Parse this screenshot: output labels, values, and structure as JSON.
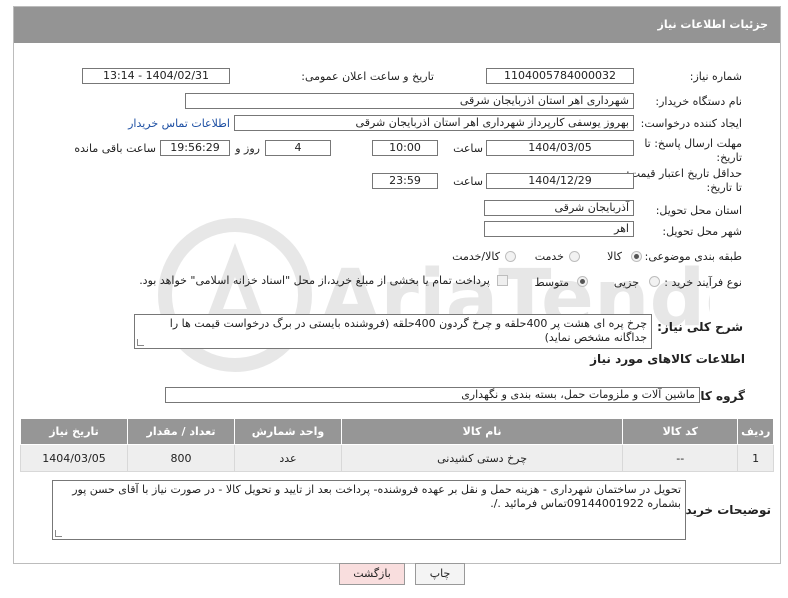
{
  "header": {
    "title": "جزئیات اطلاعات نیاز"
  },
  "fields": {
    "need_number_label": "شماره نیاز:",
    "need_number": "1104005784000032",
    "announce_label": "تاریخ و ساعت اعلان عمومی:",
    "announce_value": "1404/02/31 - 13:14",
    "buyer_org_label": "نام دستگاه خریدار:",
    "buyer_org": "شهرداری اهر استان اذربایجان شرقی",
    "requester_label": "ایجاد کننده درخواست:",
    "requester": "بهروز یوسفی کارپرداز شهرداری اهر استان اذربایجان شرقی",
    "contact_link": "اطلاعات تماس خریدار",
    "deadline_label": "مهلت ارسال پاسخ: تا",
    "deadline_label2": "تاریخ:",
    "deadline_date": "1404/03/05",
    "time_label": "ساعت",
    "deadline_time": "10:00",
    "days_value": "4",
    "days_label": "روز و",
    "remaining_time": "19:56:29",
    "remaining_label": "ساعت باقی مانده",
    "validity_label": "حداقل تاریخ اعتبار قیمت:",
    "validity_label2": "تا تاریخ:",
    "validity_date": "1404/12/29",
    "validity_time": "23:59",
    "province_label": "استان محل تحویل:",
    "province": "آذربایجان شرقی",
    "city_label": "شهر محل تحویل:",
    "city": "اهر",
    "category_label": "طبقه بندی موضوعی:",
    "category_options": [
      "کالا",
      "خدمت",
      "کالا/خدمت"
    ],
    "process_label": "نوع فرآیند خرید :",
    "process_options": [
      "جزیی",
      "متوسط"
    ],
    "payment_note": "پرداخت تمام یا بخشی از مبلغ خرید،از محل \"اسناد خزانه اسلامی\" خواهد بود."
  },
  "description": {
    "label": "شرح کلی نیاز:",
    "text": "چرخ پره ای هشت پر 400حلقه و چرخ گردون 400حلقه (فروشنده بایستی در برگ درخواست قیمت ها را جداگانه مشخص نماید)"
  },
  "goods": {
    "section_title": "اطلاعات کالاهای مورد نیاز",
    "group_label": "گروه کالا:",
    "group_value": "ماشین آلات و ملزومات حمل، بسته بندی و نگهداری",
    "columns": [
      "ردیف",
      "کد کالا",
      "نام کالا",
      "واحد شمارش",
      "تعداد / مقدار",
      "تاریخ نیاز"
    ],
    "rows": [
      {
        "index": "1",
        "code": "--",
        "name": "چرخ دستی کشیدنی",
        "unit": "عدد",
        "qty": "800",
        "date": "1404/03/05"
      }
    ]
  },
  "buyer_notes": {
    "label": "توضیحات خریدار:",
    "text": "تحویل در ساختمان شهرداری - هزینه حمل و نقل بر عهده فروشنده- پرداخت بعد از تایید و تحویل کالا - در صورت نیاز با آقای حسن پور بشماره 09144001922تماس فرمائید ./."
  },
  "buttons": {
    "print": "چاپ",
    "back": "بازگشت"
  },
  "watermark": "AriaTender.neT",
  "colors": {
    "header": "#949494",
    "link": "#1d4fa3",
    "back_button": "#f9dede"
  }
}
